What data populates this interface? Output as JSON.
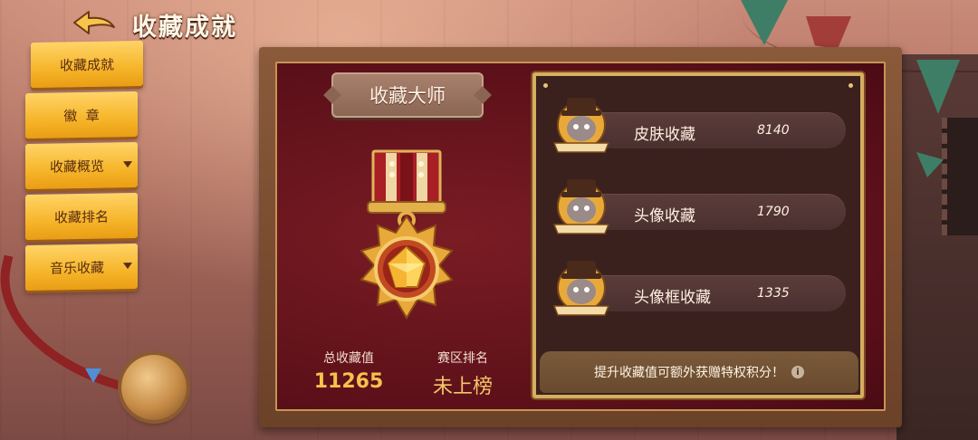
{
  "header": {
    "title": "收藏成就"
  },
  "sidebar": {
    "items": [
      {
        "label": "收藏成就",
        "has_dropdown": false,
        "active": true
      },
      {
        "label": "徽  章",
        "has_dropdown": false,
        "active": false
      },
      {
        "label": "收藏概览",
        "has_dropdown": true,
        "active": false
      },
      {
        "label": "收藏排名",
        "has_dropdown": false,
        "active": false
      },
      {
        "label": "音乐收藏",
        "has_dropdown": true,
        "active": false
      }
    ]
  },
  "board": {
    "rank_title": "收藏大师",
    "stats": {
      "total_label": "总收藏值",
      "total_value": "11265",
      "region_label": "赛区排名",
      "region_value": "未上榜"
    },
    "collections": [
      {
        "name": "皮肤收藏",
        "value": "8140"
      },
      {
        "name": "头像收藏",
        "value": "1790"
      },
      {
        "name": "头像框收藏",
        "value": "1335"
      }
    ],
    "tip": "提升收藏值可额外获赠特权积分！"
  },
  "colors": {
    "sidebar_button": "#f6b52a",
    "board_red": "#5c1019",
    "gold": "#d7ad60",
    "stat_value": "#f5c24c"
  },
  "icons": {
    "back": "back-arrow-icon",
    "medal": "medal-icon",
    "badge": "tom-cat-badge-icon",
    "info": "info-icon"
  }
}
